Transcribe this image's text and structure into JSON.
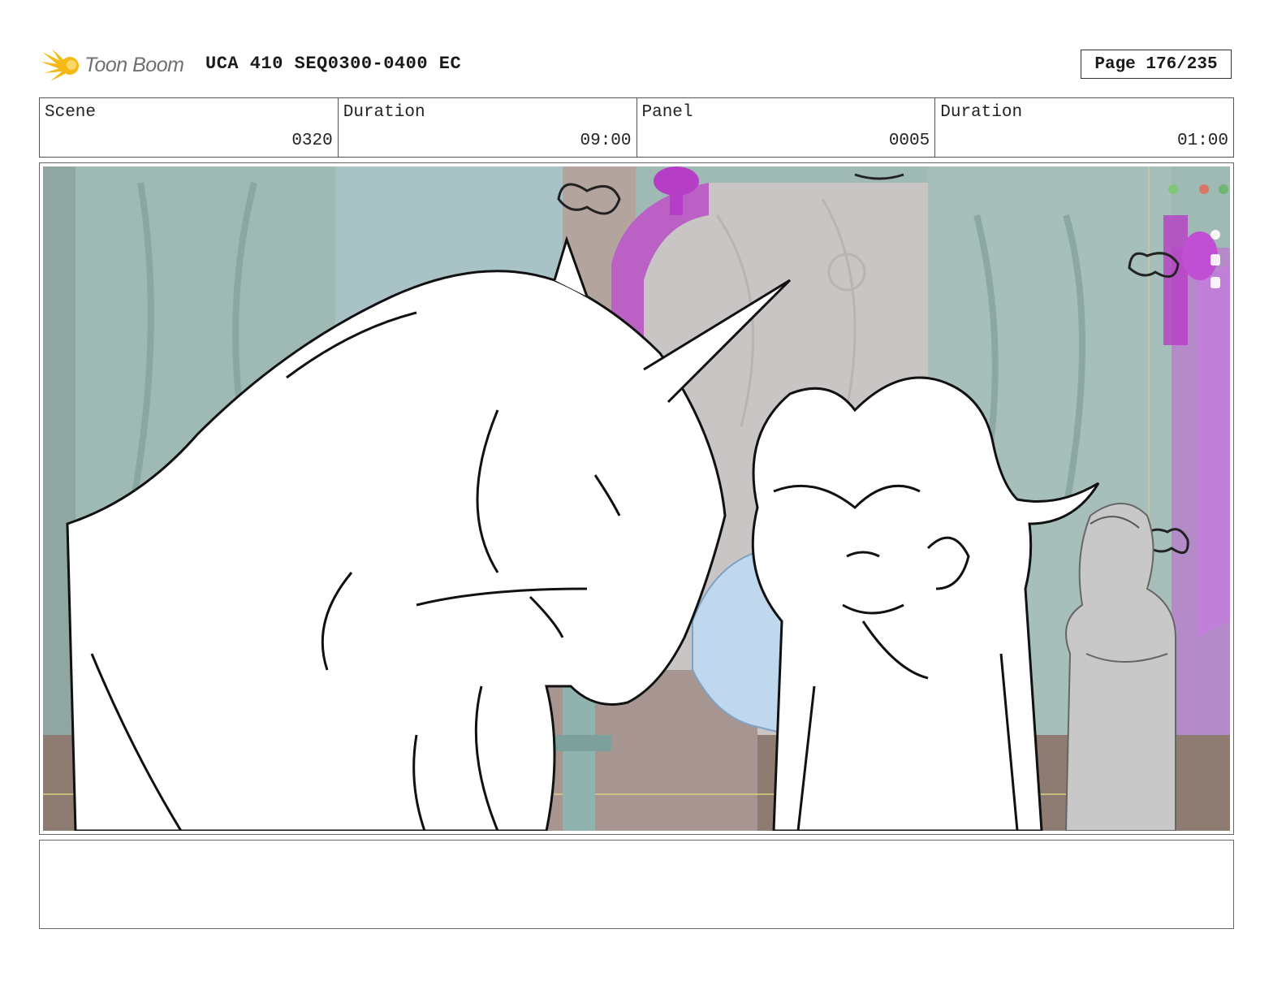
{
  "header": {
    "brand": "Toon Boom",
    "title": "UCA 410 SEQ0300-0400 EC",
    "page": "Page 176/235"
  },
  "info": {
    "scene_label": "Scene",
    "scene_value": "0320",
    "scene_duration_label": "Duration",
    "scene_duration_value": "09:00",
    "panel_label": "Panel",
    "panel_value": "0005",
    "panel_duration_label": "Duration",
    "panel_duration_value": "01:00"
  },
  "panel": {
    "icons": [
      "unicorn-sketch",
      "girl-sketch",
      "boy-sketch",
      "butterfly-icon",
      "ornate-interior"
    ]
  },
  "notes": {
    "text": ""
  },
  "colors": {
    "logo_yellow": "#f5b814",
    "wall_teal": "#9fb9b5",
    "accent_magenta": "#b63dc6",
    "floor_brown": "#8e7b72",
    "sketch_line": "#111111",
    "blue_figure": "#bfd8ee"
  }
}
